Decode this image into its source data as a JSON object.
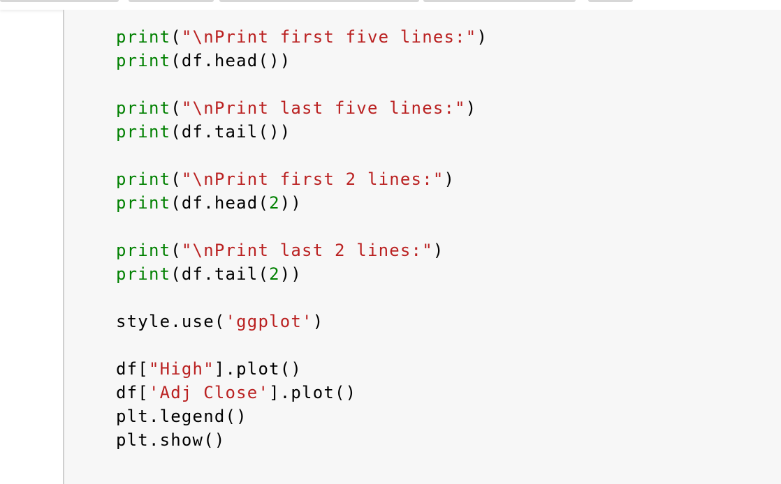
{
  "colors": {
    "builtin": "#008000",
    "string": "#ba2121",
    "number": "#008000",
    "plain": "#000000",
    "cell_background": "#f7f7f7",
    "cell_border": "#cfcfcf"
  },
  "code_lines": [
    [
      {
        "t": "builtin",
        "v": "print"
      },
      {
        "t": "plain",
        "v": "("
      },
      {
        "t": "string",
        "v": "\"\\nPrint first five lines:\""
      },
      {
        "t": "plain",
        "v": ")"
      }
    ],
    [
      {
        "t": "builtin",
        "v": "print"
      },
      {
        "t": "plain",
        "v": "(df.head())"
      }
    ],
    [],
    [
      {
        "t": "builtin",
        "v": "print"
      },
      {
        "t": "plain",
        "v": "("
      },
      {
        "t": "string",
        "v": "\"\\nPrint last five lines:\""
      },
      {
        "t": "plain",
        "v": ")"
      }
    ],
    [
      {
        "t": "builtin",
        "v": "print"
      },
      {
        "t": "plain",
        "v": "(df.tail())"
      }
    ],
    [],
    [
      {
        "t": "builtin",
        "v": "print"
      },
      {
        "t": "plain",
        "v": "("
      },
      {
        "t": "string",
        "v": "\"\\nPrint first 2 lines:\""
      },
      {
        "t": "plain",
        "v": ")"
      }
    ],
    [
      {
        "t": "builtin",
        "v": "print"
      },
      {
        "t": "plain",
        "v": "(df.head("
      },
      {
        "t": "number",
        "v": "2"
      },
      {
        "t": "plain",
        "v": "))"
      }
    ],
    [],
    [
      {
        "t": "builtin",
        "v": "print"
      },
      {
        "t": "plain",
        "v": "("
      },
      {
        "t": "string",
        "v": "\"\\nPrint last 2 lines:\""
      },
      {
        "t": "plain",
        "v": ")"
      }
    ],
    [
      {
        "t": "builtin",
        "v": "print"
      },
      {
        "t": "plain",
        "v": "(df.tail("
      },
      {
        "t": "number",
        "v": "2"
      },
      {
        "t": "plain",
        "v": "))"
      }
    ],
    [],
    [
      {
        "t": "plain",
        "v": "style.use("
      },
      {
        "t": "string",
        "v": "'ggplot'"
      },
      {
        "t": "plain",
        "v": ")"
      }
    ],
    [],
    [
      {
        "t": "plain",
        "v": "df["
      },
      {
        "t": "string",
        "v": "\"High\""
      },
      {
        "t": "plain",
        "v": "].plot()"
      }
    ],
    [
      {
        "t": "plain",
        "v": "df["
      },
      {
        "t": "string",
        "v": "'Adj Close'"
      },
      {
        "t": "plain",
        "v": "].plot()"
      }
    ],
    [
      {
        "t": "plain",
        "v": "plt.legend()"
      }
    ],
    [
      {
        "t": "plain",
        "v": "plt.show()"
      }
    ]
  ]
}
